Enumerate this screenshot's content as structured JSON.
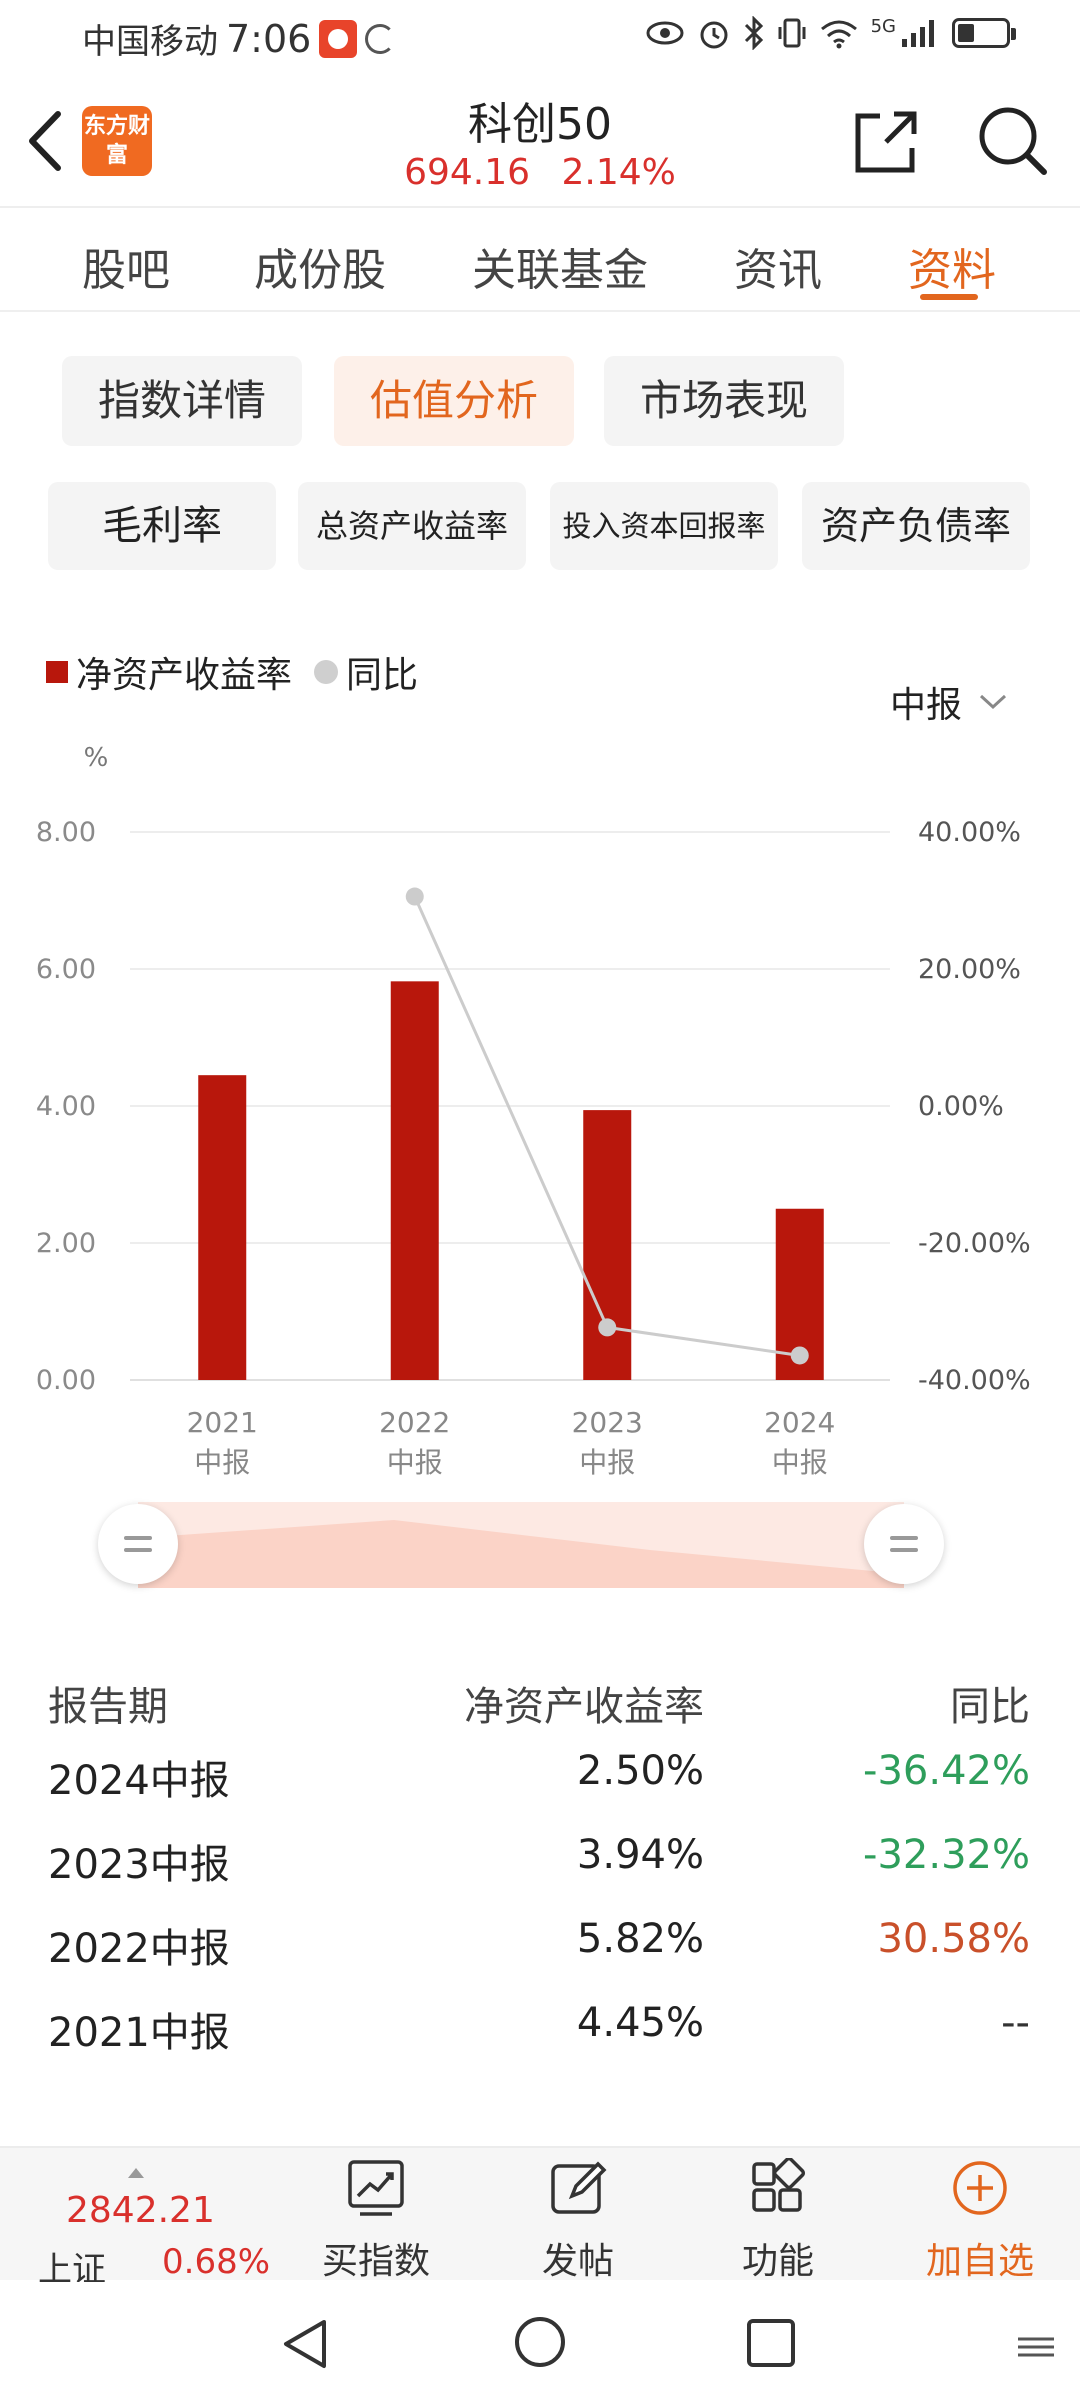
{
  "status_bar": {
    "carrier": "中国移动",
    "time": "7:06",
    "network": "5G"
  },
  "header": {
    "logo_text": "东方财富",
    "title": "科创50",
    "price": "694.16",
    "change_pct": "2.14%"
  },
  "main_tabs": [
    {
      "label": "股吧",
      "active": false
    },
    {
      "label": "成份股",
      "active": false
    },
    {
      "label": "关联基金",
      "active": false
    },
    {
      "label": "资讯",
      "active": false
    },
    {
      "label": "资料",
      "active": true
    }
  ],
  "sub_tabs": [
    {
      "label": "指数详情",
      "active": false
    },
    {
      "label": "估值分析",
      "active": true
    },
    {
      "label": "市场表现",
      "active": false
    }
  ],
  "metric_tabs": [
    {
      "label": "毛利率"
    },
    {
      "label": "总资产收益率"
    },
    {
      "label": "投入资本回报率"
    },
    {
      "label": "资产负债率"
    }
  ],
  "legend": {
    "bar": "净资产收益率",
    "line": "同比"
  },
  "period_select": "中报",
  "colors": {
    "accent": "#e2661e",
    "bar": "#b8170c",
    "up": "#d9302c",
    "down": "#2e9e5b",
    "line": "#cccccc"
  },
  "chart_data": {
    "type": "bar",
    "categories": [
      "2021中报",
      "2022中报",
      "2023中报",
      "2024中报"
    ],
    "category_lines": [
      [
        "2021",
        "中报"
      ],
      [
        "2022",
        "中报"
      ],
      [
        "2023",
        "中报"
      ],
      [
        "2024",
        "中报"
      ]
    ],
    "series": [
      {
        "name": "净资产收益率",
        "type": "bar",
        "axis": "left",
        "values": [
          4.45,
          5.82,
          3.94,
          2.5
        ]
      },
      {
        "name": "同比",
        "type": "line",
        "axis": "right",
        "values": [
          null,
          30.58,
          -32.32,
          -36.42
        ]
      }
    ],
    "ylabel": "%",
    "ylim": [
      0,
      8
    ],
    "y_ticks": [
      "0.00",
      "2.00",
      "4.00",
      "6.00",
      "8.00"
    ],
    "y2lim": [
      -40,
      40
    ],
    "y2_ticks": [
      "-40.00%",
      "-20.00%",
      "0.00%",
      "20.00%",
      "40.00%"
    ],
    "grid": true,
    "legend_position": "top-left"
  },
  "table": {
    "headers": {
      "period": "报告期",
      "roe": "净资产收益率",
      "yoy": "同比"
    },
    "rows": [
      {
        "period": "2024中报",
        "roe": "2.50%",
        "yoy": "-36.42%",
        "trend": "down"
      },
      {
        "period": "2023中报",
        "roe": "3.94%",
        "yoy": "-32.32%",
        "trend": "down"
      },
      {
        "period": "2022中报",
        "roe": "5.82%",
        "yoy": "30.58%",
        "trend": "up"
      },
      {
        "period": "2021中报",
        "roe": "4.45%",
        "yoy": "--",
        "trend": "none"
      }
    ]
  },
  "bottom_bar": {
    "index_value": "2842.21",
    "index_name": "上证",
    "index_pct": "0.68%",
    "buy_label": "买指数",
    "post_label": "发帖",
    "func_label": "功能",
    "add_label": "加自选"
  }
}
